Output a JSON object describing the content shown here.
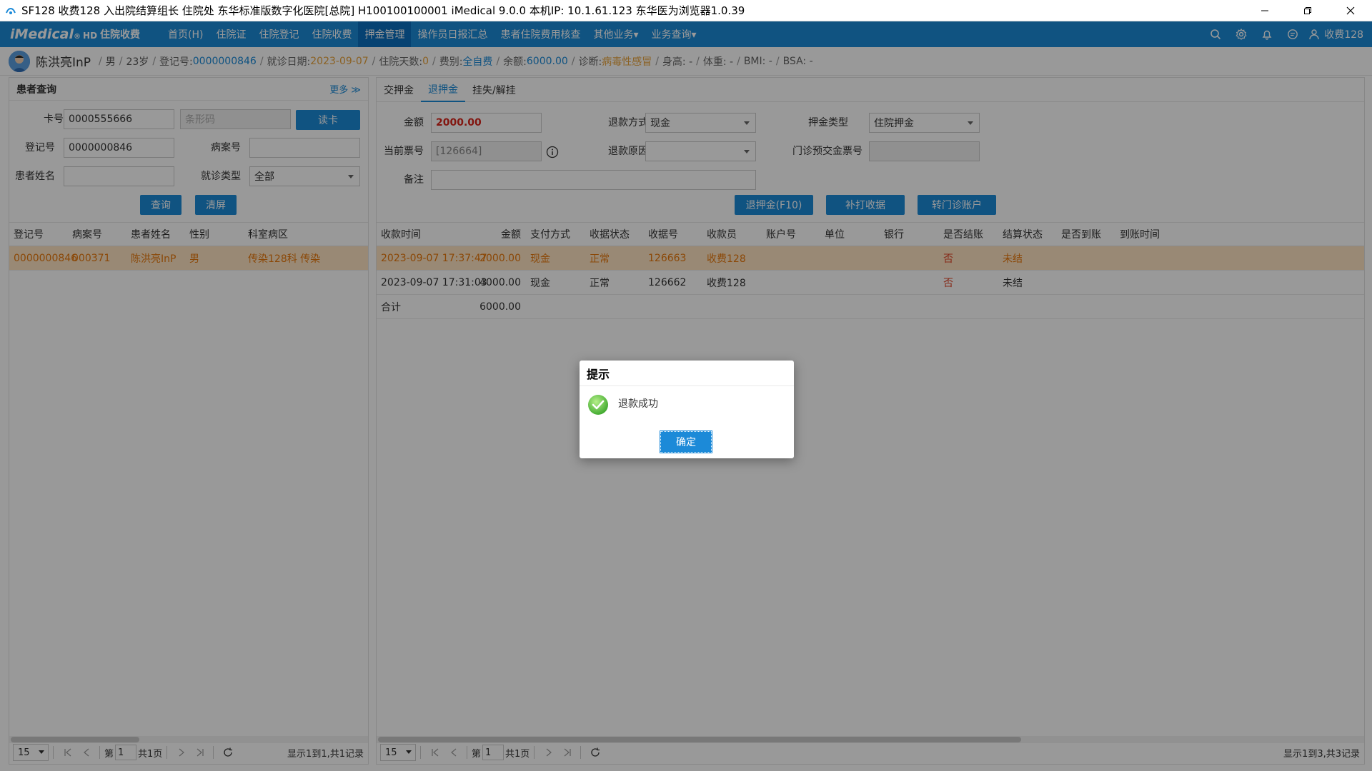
{
  "window": {
    "title": "SF128 收费128 入出院结算组长 住院处 东华标准版数字化医院[总院] H100100100001 iMedical 9.0.0 本机IP: 10.1.61.123  东华医为浏览器1.0.39"
  },
  "navbar": {
    "logo": "iMedical",
    "logo_mark": "®",
    "logo_suffix": "HD",
    "module": "住院收费",
    "menu": [
      "首页(H)",
      "住院证",
      "住院登记",
      "住院收费",
      "押金管理",
      "操作员日报汇总",
      "患者住院费用核查",
      "其他业务▾",
      "业务查询▾"
    ],
    "active_menu_index": 4,
    "user": "收费128"
  },
  "banner": {
    "name": "陈洪亮InP",
    "gender": "男",
    "age": "23岁",
    "reg_label": "登记号:",
    "reg_no": "0000000846",
    "visit_label": "就诊日期:",
    "visit_date": "2023-09-07",
    "days_label": "住院天数:",
    "days": "0",
    "fee_label": "费别:",
    "fee_type": "全自费",
    "balance_label": "余额:",
    "balance": "6000.00",
    "diag_label": "诊断:",
    "diagnosis": "病毒性感冒",
    "height": "身高: -",
    "weight": "体重: -",
    "bmi": "BMI: -",
    "bsa": "BSA: -"
  },
  "left": {
    "title": "患者查询",
    "more": "更多 ≫",
    "card_label": "卡号",
    "card_value": "0000555666",
    "barcode_placeholder": "条形码",
    "read_card": "读卡",
    "reg_label": "登记号",
    "reg_value": "0000000846",
    "record_label": "病案号",
    "record_value": "",
    "name_label": "患者姓名",
    "name_value": "",
    "visit_type_label": "就诊类型",
    "visit_type_value": "全部",
    "query": "查询",
    "clear": "清屏",
    "columns": [
      "登记号",
      "病案号",
      "患者姓名",
      "性别",
      "科室病区"
    ],
    "rows": [
      [
        "0000000846",
        "000371",
        "陈洪亮InP",
        "男",
        "传染128科 传染"
      ]
    ],
    "pager": {
      "size": "15",
      "page_prefix": "第",
      "page": "1",
      "page_total": "共1页",
      "info": "显示1到1,共1记录"
    }
  },
  "right": {
    "tabs": [
      "交押金",
      "退押金",
      "挂失/解挂"
    ],
    "active_tab": 1,
    "amount_label": "金额",
    "amount_value": "2000.00",
    "refund_method_label": "退款方式",
    "refund_method_value": "现金",
    "deposit_type_label": "押金类型",
    "deposit_type_value": "住院押金",
    "receipt_label": "当前票号",
    "receipt_value": "[126664]",
    "refund_reason_label": "退款原因",
    "refund_reason_value": "",
    "outpatient_label": "门诊预交金票号",
    "outpatient_value": "",
    "remark_label": "备注",
    "remark_value": "",
    "btn_refund": "退押金(F10)",
    "btn_reprint": "补打收据",
    "btn_transfer": "转门诊账户",
    "columns": [
      "收款时间",
      "金额",
      "支付方式",
      "收据状态",
      "收据号",
      "收款员",
      "账户号",
      "单位",
      "银行",
      "是否结账",
      "结算状态",
      "是否到账",
      "到账时间"
    ],
    "rows": [
      [
        "2023-09-07 17:37:47",
        "2000.00",
        "现金",
        "正常",
        "126663",
        "收费128",
        "",
        "",
        "",
        "否",
        "未结",
        "",
        ""
      ],
      [
        "2023-09-07 17:31:03",
        "4000.00",
        "现金",
        "正常",
        "126662",
        "收费128",
        "",
        "",
        "",
        "否",
        "未结",
        "",
        ""
      ]
    ],
    "total_label": "合计",
    "total_value": "6000.00",
    "pager": {
      "size": "15",
      "page_prefix": "第",
      "page": "1",
      "page_total": "共1页",
      "info": "显示1到3,共3记录"
    }
  },
  "dialog": {
    "title": "提示",
    "message": "退款成功",
    "ok": "确定"
  },
  "colors": {
    "accent": "#1c8ad8",
    "selected_row": "#ffe4c4",
    "warning_text": "#e0472b",
    "success": "#52c41a"
  }
}
